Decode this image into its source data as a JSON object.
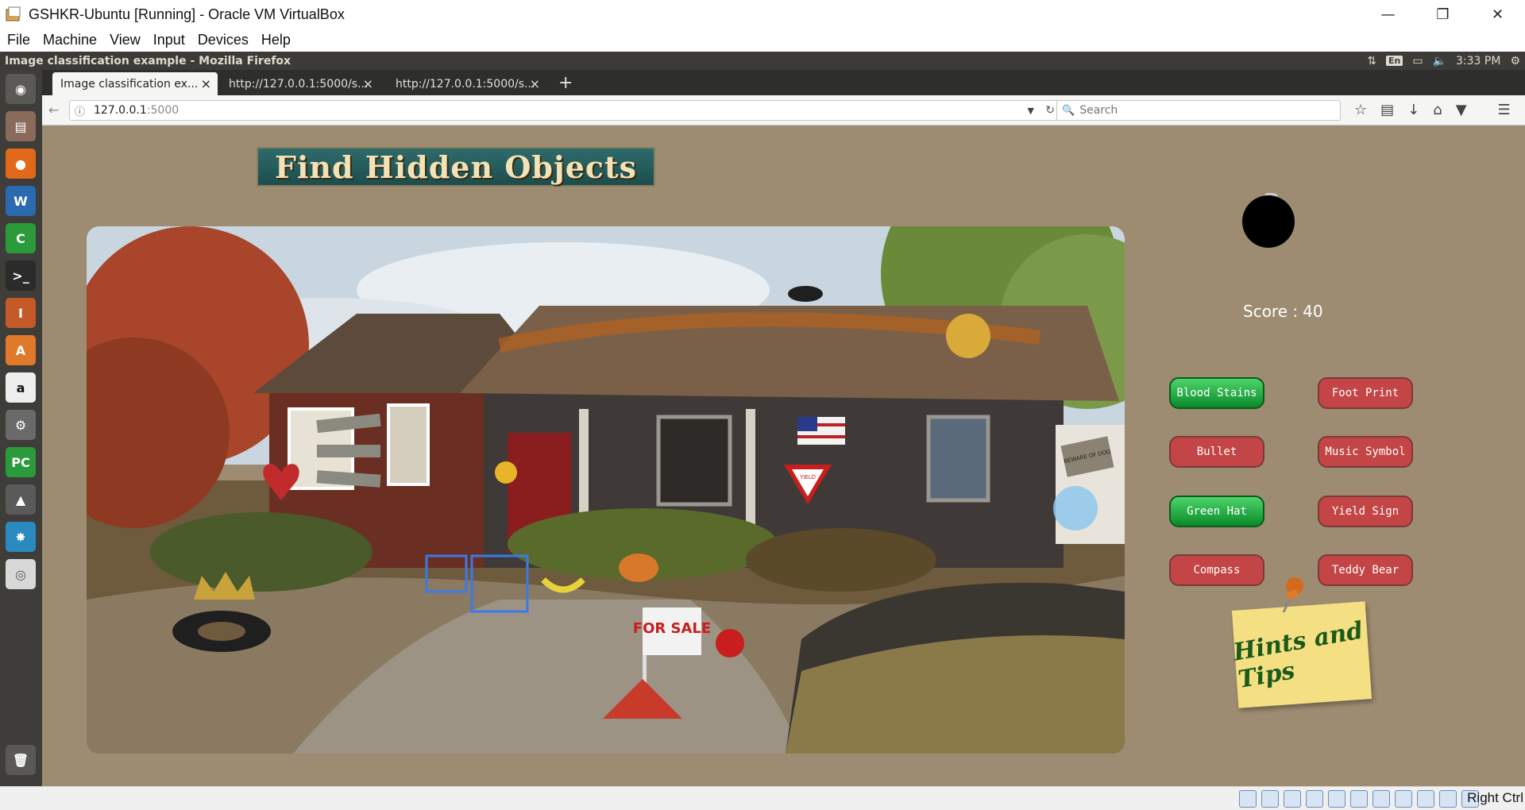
{
  "vbox": {
    "title": "GSHKR-Ubuntu [Running] - Oracle VM VirtualBox",
    "menu": [
      "File",
      "Machine",
      "View",
      "Input",
      "Devices",
      "Help"
    ],
    "host_key": "Right Ctrl"
  },
  "ubuntu": {
    "window_title": "Image classification example - Mozilla Firefox",
    "keyboard_layout": "En",
    "clock": "3:33 PM",
    "launcher": [
      "dash-icon",
      "files-icon",
      "firefox-icon",
      "writer-icon",
      "calc-icon",
      "terminal-icon",
      "impress-icon",
      "software-center-icon",
      "amazon-icon",
      "settings-icon",
      "pycharm-icon",
      "software-updater-icon",
      "unity-icon",
      "dvd-icon",
      "trash-icon"
    ]
  },
  "firefox": {
    "tabs": [
      {
        "label": "Image classification ex...",
        "active": true
      },
      {
        "label": "http://127.0.0.1:5000/s...",
        "active": false
      },
      {
        "label": "http://127.0.0.1:5000/s...",
        "active": false
      }
    ],
    "url_host": "127.0.0.1",
    "url_port": ":5000",
    "search_placeholder": "Search"
  },
  "game": {
    "banner": "Find Hidden Objects",
    "score_label": "Score :",
    "score_value": "40",
    "objects": [
      {
        "label": "Blood Stains",
        "found": true
      },
      {
        "label": "Foot Print",
        "found": false
      },
      {
        "label": "Bullet",
        "found": false
      },
      {
        "label": "Music Symbol",
        "found": false
      },
      {
        "label": "Green Hat",
        "found": true
      },
      {
        "label": "Yield Sign",
        "found": false
      },
      {
        "label": "Compass",
        "found": false
      },
      {
        "label": "Teddy Bear",
        "found": false
      }
    ],
    "hints_label": "Hints and Tips",
    "scene_labels": {
      "for_sale": "FOR SALE",
      "yield": "YIELD",
      "beware": "BEWARE OF DOG"
    },
    "colors": {
      "page_bg": "#9e8c72",
      "found": "#1aa83a",
      "not_found": "#c44545"
    }
  }
}
